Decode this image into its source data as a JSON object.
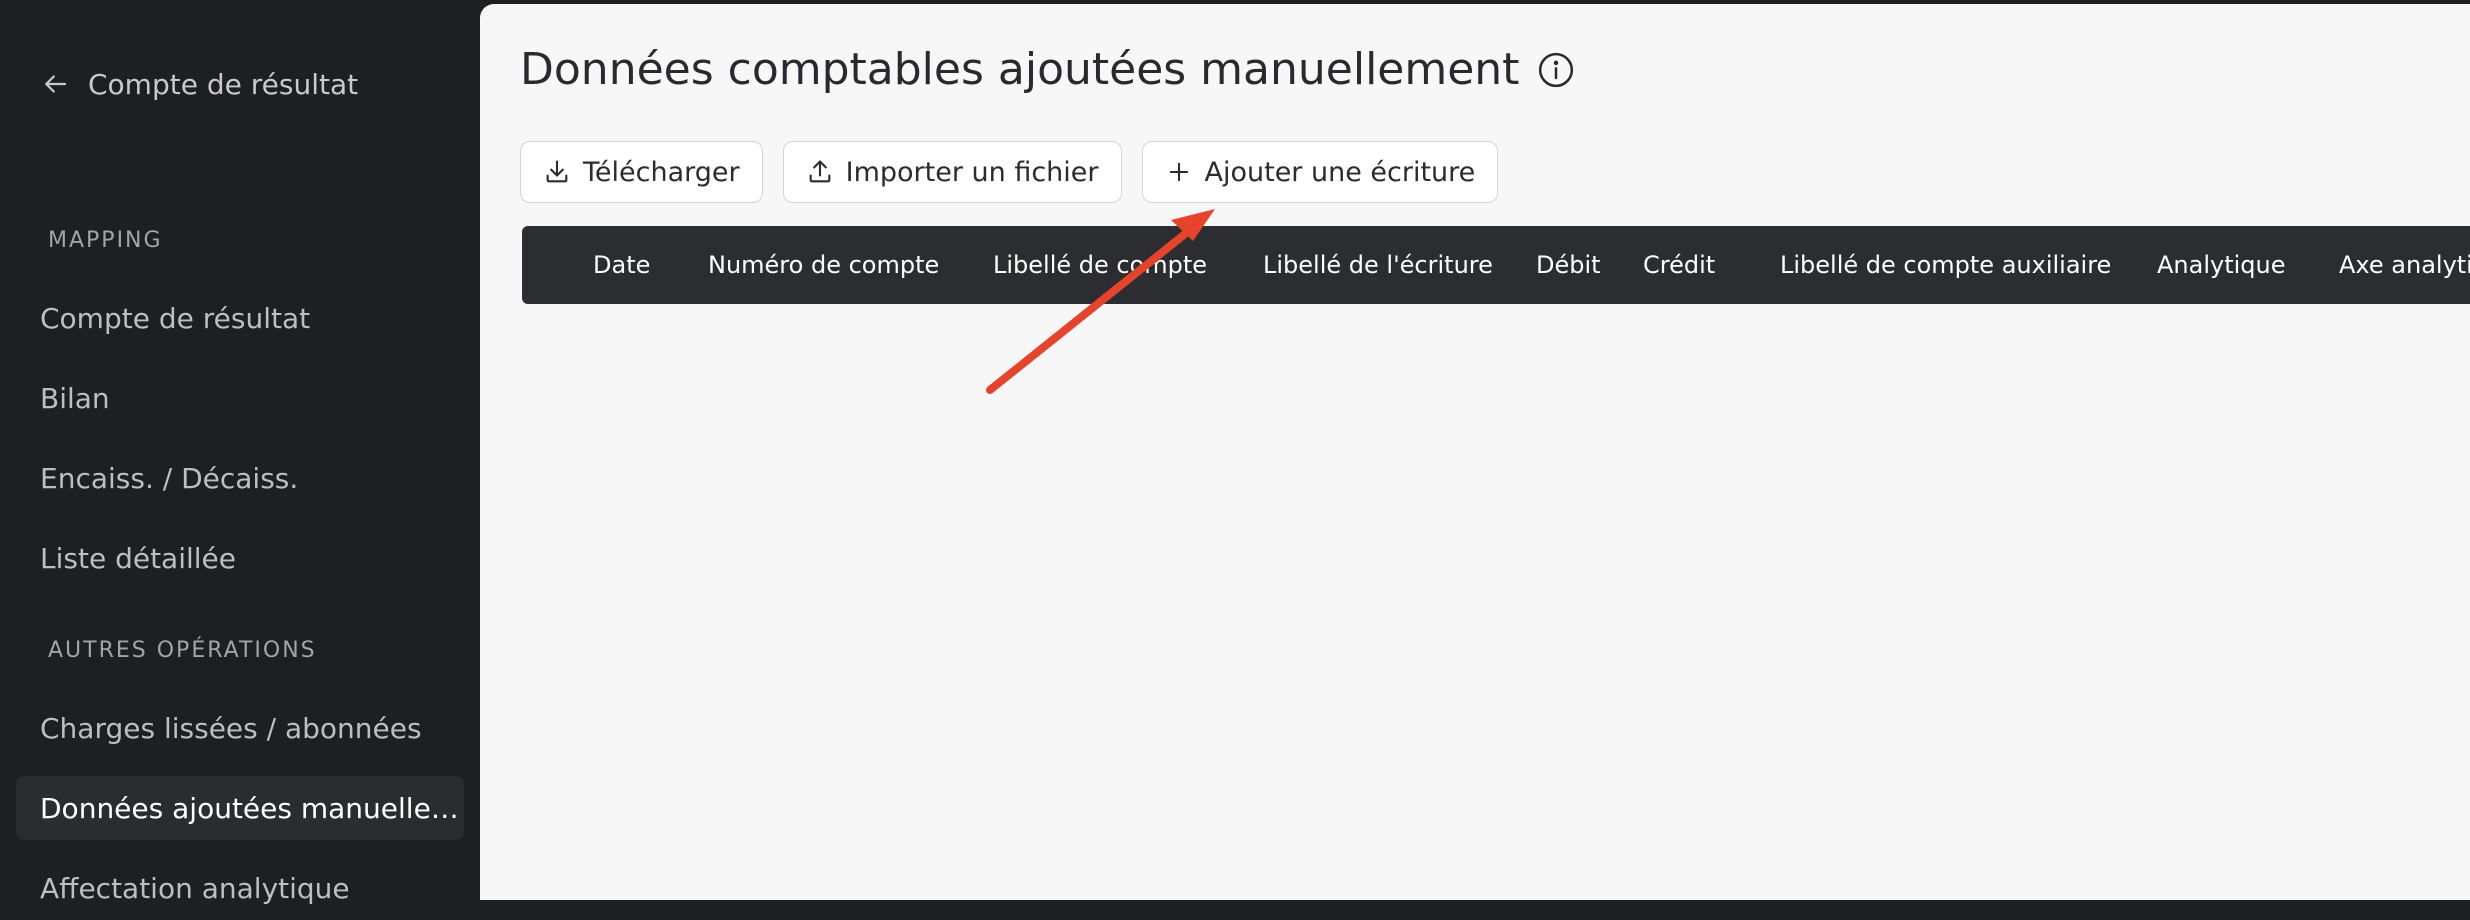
{
  "sidebar": {
    "back_label": "Compte de résultat",
    "sections": [
      {
        "title": "MAPPING",
        "items": [
          {
            "label": "Compte de résultat"
          },
          {
            "label": "Bilan"
          },
          {
            "label": "Encaiss. / Décaiss."
          },
          {
            "label": "Liste détaillée"
          }
        ]
      },
      {
        "title": "AUTRES OPÉRATIONS",
        "items": [
          {
            "label": "Charges lissées / abonnées"
          },
          {
            "label": "Données ajoutées manuellement",
            "active": true
          },
          {
            "label": "Affectation analytique"
          }
        ]
      }
    ]
  },
  "main": {
    "title": "Données comptables ajoutées manuellement",
    "toolbar": {
      "download_label": "Télécharger",
      "import_label": "Importer un fichier",
      "add_label": "Ajouter une écriture"
    },
    "table": {
      "columns": [
        "Date",
        "Numéro de compte",
        "Libellé de compte",
        "Libellé de l'écriture",
        "Débit",
        "Crédit",
        "Libellé de compte auxiliaire",
        "Analytique",
        "Axe analytique"
      ]
    },
    "annotation": {
      "arrow_color": "#e5432b"
    }
  },
  "colors": {
    "sidebar_bg": "#1e1f22",
    "main_bg": "#f7f7f7",
    "table_header_bg": "#2c2d31",
    "active_item_bg": "#2b2c30"
  }
}
